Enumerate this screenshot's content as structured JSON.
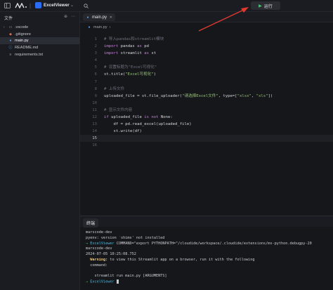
{
  "topbar": {
    "app_name": "ExcelViewer",
    "run_label": "运行"
  },
  "sidebar": {
    "header": "文件",
    "files": [
      {
        "name": ".vscode",
        "type": "folder",
        "icon": "folder-icon"
      },
      {
        "name": ".gitignore",
        "type": "file",
        "icon": "git-icon"
      },
      {
        "name": "main.py",
        "type": "file",
        "icon": "python-icon",
        "active": true
      },
      {
        "name": "README.md",
        "type": "file",
        "icon": "markdown-icon"
      },
      {
        "name": "requirements.txt",
        "type": "file",
        "icon": "text-file-icon"
      }
    ]
  },
  "editor": {
    "tab_label": "main.py",
    "breadcrumb": "main.py",
    "code_lines": [
      {
        "n": "1",
        "tokens": [
          {
            "t": "# 导入pandas和streamlit模块",
            "c": "cm"
          }
        ]
      },
      {
        "n": "2",
        "tokens": [
          {
            "t": "import",
            "c": "kw"
          },
          {
            "t": " pandas ",
            "c": ""
          },
          {
            "t": "as",
            "c": "kw"
          },
          {
            "t": " pd",
            "c": ""
          }
        ]
      },
      {
        "n": "3",
        "tokens": [
          {
            "t": "import",
            "c": "kw"
          },
          {
            "t": " streamlit ",
            "c": ""
          },
          {
            "t": "as",
            "c": "kw"
          },
          {
            "t": " st",
            "c": ""
          }
        ]
      },
      {
        "n": "4",
        "tokens": []
      },
      {
        "n": "5",
        "tokens": [
          {
            "t": "# 设置标题为\"Excel可视化\"",
            "c": "cm"
          }
        ]
      },
      {
        "n": "6",
        "tokens": [
          {
            "t": "st.title(",
            "c": ""
          },
          {
            "t": "\"Excel可视化\"",
            "c": "st"
          },
          {
            "t": ")",
            "c": ""
          }
        ]
      },
      {
        "n": "7",
        "tokens": []
      },
      {
        "n": "8",
        "tokens": [
          {
            "t": "# 上传文件",
            "c": "cm"
          }
        ]
      },
      {
        "n": "9",
        "tokens": [
          {
            "t": "uploaded_file = st.file_uploader(",
            "c": ""
          },
          {
            "t": "\"请选择Excel文件\"",
            "c": "st"
          },
          {
            "t": ", type=[",
            "c": ""
          },
          {
            "t": "\"xlsx\"",
            "c": "st"
          },
          {
            "t": ", ",
            "c": ""
          },
          {
            "t": "\"xls\"",
            "c": "st"
          },
          {
            "t": "])",
            "c": ""
          }
        ]
      },
      {
        "n": "10",
        "tokens": []
      },
      {
        "n": "11",
        "tokens": [
          {
            "t": "# 显示文件内容",
            "c": "cm"
          }
        ]
      },
      {
        "n": "12",
        "tokens": [
          {
            "t": "if",
            "c": "kw"
          },
          {
            "t": " uploaded_file ",
            "c": ""
          },
          {
            "t": "is not",
            "c": "kw"
          },
          {
            "t": " None:",
            "c": ""
          }
        ]
      },
      {
        "n": "13",
        "tokens": [
          {
            "t": "    df = pd.read_excel(uploaded_file)",
            "c": ""
          }
        ]
      },
      {
        "n": "14",
        "tokens": [
          {
            "t": "    st.write(df)",
            "c": ""
          }
        ]
      },
      {
        "n": "15",
        "tokens": [],
        "current": true
      },
      {
        "n": "16",
        "tokens": []
      }
    ]
  },
  "terminal": {
    "tab_label": "终端",
    "lines": [
      [
        {
          "t": "marscode-dev",
          "c": ""
        }
      ],
      [
        {
          "t": "pyenv: version `shims' not installed",
          "c": ""
        }
      ],
      [
        {
          "t": "→ ",
          "c": "t-arrow"
        },
        {
          "t": "ExcelViewer",
          "c": "t-env"
        },
        {
          "t": " COMMAND=\"export PYTHONPATH=\"/cloudide/workspace/.cloudide/extensions/ms-python.debugpy-20",
          "c": ""
        }
      ],
      [
        {
          "t": "marscode-dev",
          "c": ""
        }
      ],
      [
        {
          "t": "2024-07-05 10:25:08.752",
          "c": ""
        }
      ],
      [
        {
          "t": "  Warning:",
          "c": "t-warn"
        },
        {
          "t": " to view this Streamlit app on a browser, run it with the following",
          "c": ""
        }
      ],
      [
        {
          "t": "  command:",
          "c": ""
        }
      ],
      [
        {
          "t": "",
          "c": ""
        }
      ],
      [
        {
          "t": "    streamlit run main.py [ARGUMENTS]",
          "c": ""
        }
      ],
      [
        {
          "t": "→ ",
          "c": "t-arrow"
        },
        {
          "t": "ExcelViewer",
          "c": "t-env"
        },
        {
          "t": " ",
          "c": ""
        }
      ]
    ]
  },
  "colors": {
    "annotation_arrow": "#e03a2f",
    "accent": "#2a6df4"
  }
}
